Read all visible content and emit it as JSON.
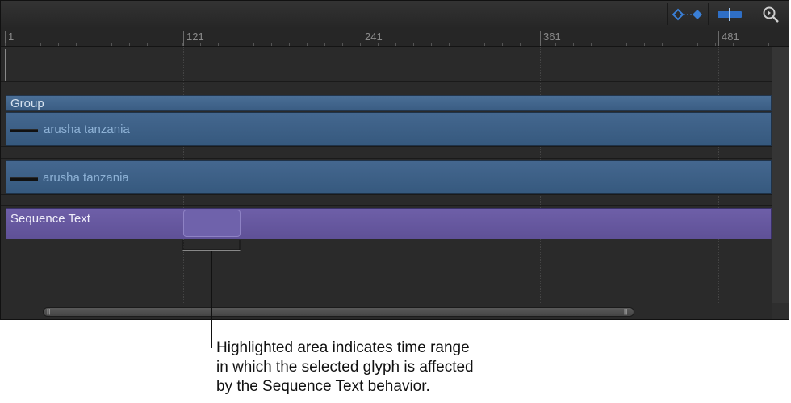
{
  "toolbar": {
    "buttons": [
      {
        "name": "keyframe-nav-button",
        "icon": "keyframe-diamond-icon"
      },
      {
        "name": "snap-button",
        "icon": "snap-icon"
      },
      {
        "name": "zoom-button",
        "icon": "zoom-icon"
      }
    ],
    "accent": "#3a7fd6"
  },
  "ruler": {
    "labels": [
      "1",
      "121",
      "241",
      "361",
      "481"
    ]
  },
  "tracks": {
    "group_label": "Group",
    "layers": [
      {
        "label": "arusha tanzania"
      },
      {
        "label": "arusha tanzania"
      }
    ],
    "sequence_label": "Sequence Text"
  },
  "colors": {
    "group_text": "#d6e2ef",
    "layer_text": "#8eb2d6",
    "sequence_text": "#f0eefa",
    "sequence_bar": "#6354a0",
    "layer_bar": "#3d6086"
  },
  "callout": {
    "text_lines": [
      "Highlighted area indicates time range",
      "in which the selected glyph is affected",
      "by the Sequence Text behavior."
    ]
  }
}
